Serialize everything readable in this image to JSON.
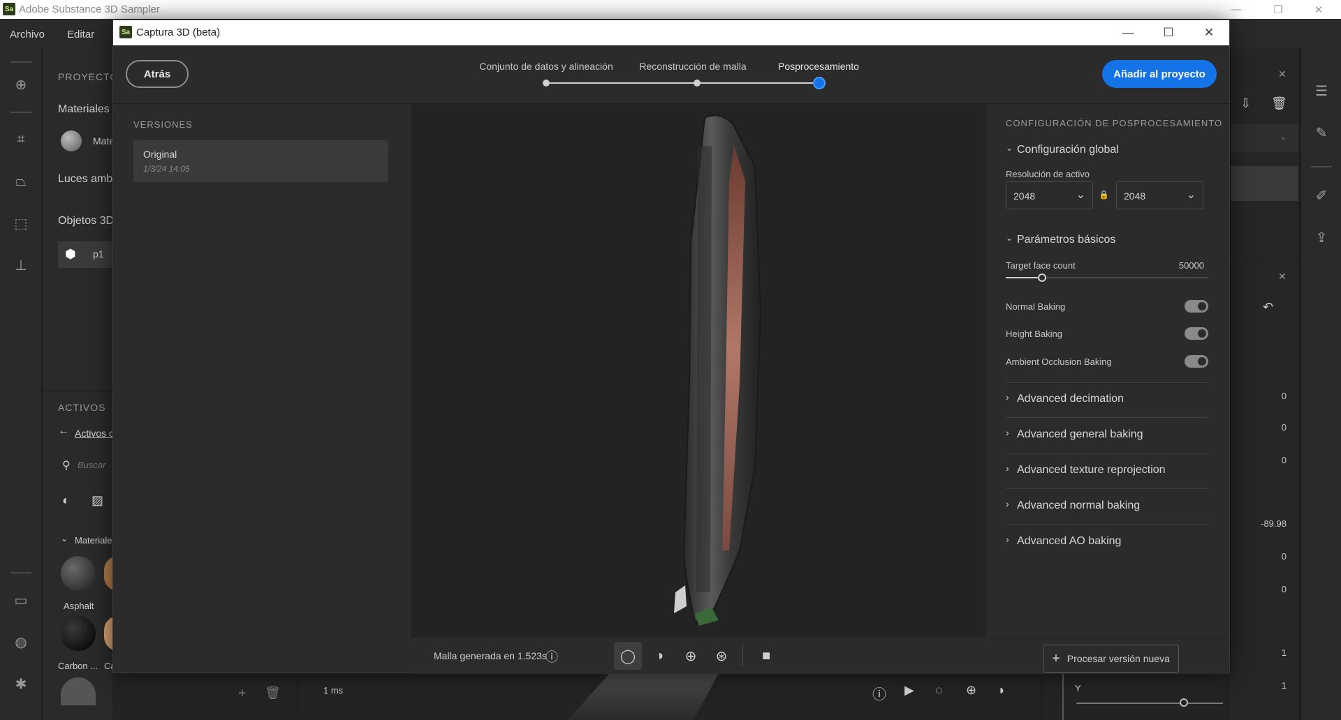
{
  "app": {
    "title": "Adobe Substance 3D Sampler",
    "icon": "Sa"
  },
  "menu": {
    "file": "Archivo",
    "edit": "Editar"
  },
  "project": {
    "header": "PROYECTO",
    "materials": "Materiales",
    "material_item": "Mate",
    "lights": "Luces amb",
    "objects": "Objetos 3D",
    "object_item": "p1"
  },
  "assets": {
    "header": "ACTIVOS",
    "back_link": "Activos c",
    "search_placeholder": "Buscar",
    "materials_group": "Materiale",
    "items": [
      {
        "label": "Asphalt",
        "color": "#3a3a3a"
      },
      {
        "label": "Carbon ...",
        "color": "#0a0a0a"
      },
      {
        "label": "Ca",
        "color": "#b07a4a"
      }
    ]
  },
  "right_values": [
    "0",
    "0",
    "0",
    "-89.98",
    "0",
    "0",
    "1",
    "1"
  ],
  "right_axis_label": "Y",
  "status": {
    "time": "1 ms"
  },
  "dialog": {
    "icon": "Sa",
    "title": "Captura 3D (beta)",
    "back": "Atrás",
    "add": "Añadir al proyecto",
    "steps": [
      "Conjunto de datos y alineación",
      "Reconstrucción de malla",
      "Posprocesamiento"
    ],
    "active_step": 2,
    "versions": {
      "header": "VERSIONES",
      "items": [
        {
          "name": "Original",
          "date": "1/3/24 14:05"
        }
      ]
    },
    "viewport": {
      "status": "Malla generada en 1.523s"
    },
    "settings": {
      "header": "CONFIGURACIÓN DE POSPROCESAMIENTO",
      "global": "Configuración global",
      "resolution_label": "Resolución de activo",
      "res_w": "2048",
      "res_h": "2048",
      "basic": "Parámetros básicos",
      "face_count_label": "Target face count",
      "face_count_value": "50000",
      "face_count_fraction": 0.18,
      "toggles": [
        {
          "label": "Normal Baking",
          "on": true
        },
        {
          "label": "Height Baking",
          "on": true
        },
        {
          "label": "Ambient Occlusion Baking",
          "on": true
        }
      ],
      "advanced": [
        "Advanced decimation",
        "Advanced general baking",
        "Advanced texture reprojection",
        "Advanced normal baking",
        "Advanced AO baking"
      ],
      "process_button": "Procesar versión nueva"
    }
  },
  "colors": {
    "accent": "#1473e6"
  }
}
